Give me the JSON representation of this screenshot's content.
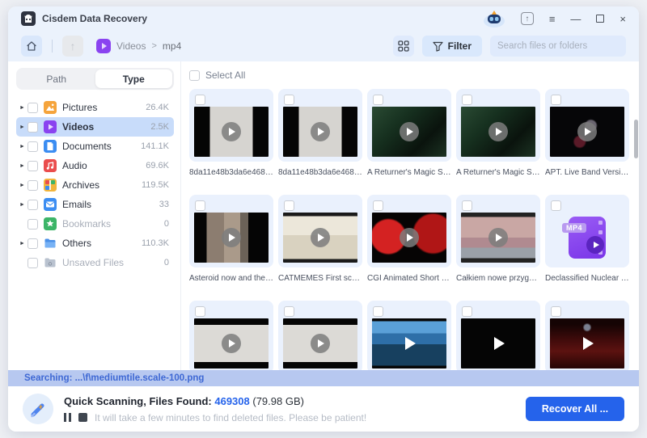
{
  "window": {
    "title": "Cisdem Data Recovery"
  },
  "titlebar": {
    "icons": {
      "share": "↑",
      "menu": "≡",
      "minimize": "—",
      "close": "×"
    }
  },
  "toolbar": {
    "breadcrumb": {
      "folder": "Videos",
      "separator": ">",
      "sub": "mp4"
    },
    "filter_label": "Filter",
    "search_placeholder": "Search files or folders"
  },
  "sidebar": {
    "tabs": {
      "path": "Path",
      "type": "Type"
    },
    "items": [
      {
        "label": "Pictures",
        "count": "26.4K"
      },
      {
        "label": "Videos",
        "count": "2.5K"
      },
      {
        "label": "Documents",
        "count": "141.1K"
      },
      {
        "label": "Audio",
        "count": "69.6K"
      },
      {
        "label": "Archives",
        "count": "119.5K"
      },
      {
        "label": "Emails",
        "count": "33"
      },
      {
        "label": "Bookmarks",
        "count": "0"
      },
      {
        "label": "Others",
        "count": "110.3K"
      },
      {
        "label": "Unsaved Files",
        "count": "0"
      }
    ]
  },
  "main": {
    "select_all_label": "Select All",
    "tiles": [
      {
        "label": "8da11e48b3da6e468d12...",
        "thumb": "pillargray"
      },
      {
        "label": "8da11e48b3da6e468d12...",
        "thumb": "pillargray"
      },
      {
        "label": "A Returner's Magic Shoul...",
        "thumb": "greenanime"
      },
      {
        "label": "A Returner's Magic Shoul...",
        "thumb": "greenanime"
      },
      {
        "label": "APT. Live Band Version By...",
        "thumb": "darkfigure"
      },
      {
        "label": "Asteroid now and then @...",
        "thumb": "person"
      },
      {
        "label": "CATMEMES  First school ...",
        "thumb": "cartoonroom"
      },
      {
        "label": "CGI Animated Short Film ...",
        "thumb": "redflowers"
      },
      {
        "label": "Całkiem nowe przygody ...",
        "thumb": "tomjerry"
      },
      {
        "label": "Declassified Nuclear Test...",
        "thumb": "mp4icon",
        "badge": "MP4"
      },
      {
        "label": "",
        "thumb": "letterboxgray"
      },
      {
        "label": "",
        "thumb": "letterboxgray"
      },
      {
        "label": "",
        "thumb": "tropical"
      },
      {
        "label": "",
        "thumb": "blackplain"
      },
      {
        "label": "",
        "thumb": "concert"
      }
    ]
  },
  "statusbar": {
    "searching": "Searching: ...\\f\\mediumtile.scale-100.png"
  },
  "footer": {
    "scan_label": "Quick Scanning, Files Found: ",
    "files_found": "469308",
    "size": " (79.98 GB)",
    "hint": "It will take a few minutes to find deleted files. Please be patient!",
    "recover_label": "Recover All ..."
  }
}
